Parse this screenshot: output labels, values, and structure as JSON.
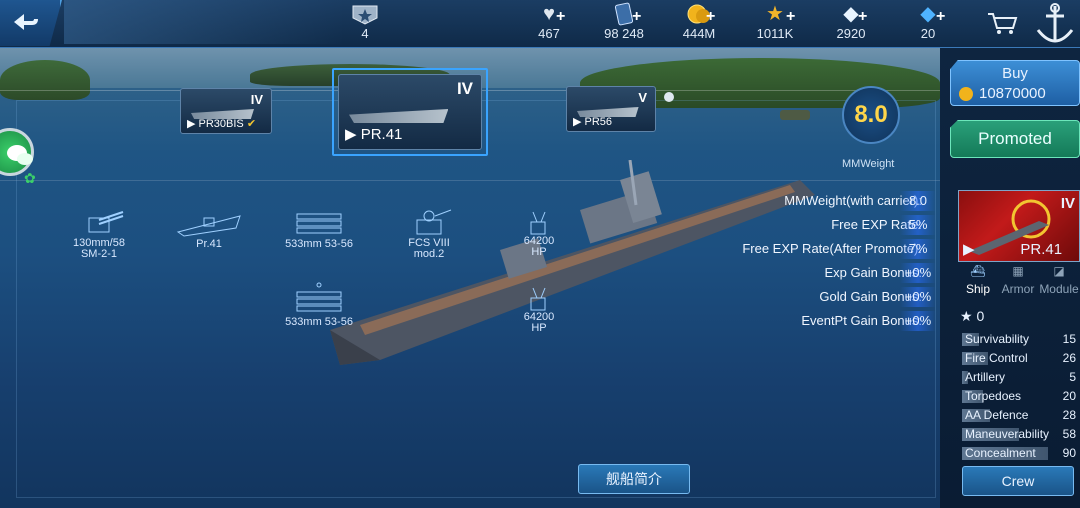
{
  "topbar": {
    "resources": [
      {
        "icon": "rank-badge-icon",
        "value": "4",
        "plus": false
      },
      {
        "icon": "heart-icon",
        "value": "467",
        "plus": true
      },
      {
        "icon": "card-icon",
        "value": "98 248",
        "plus": true
      },
      {
        "icon": "gold-coin-icon",
        "value": "444M",
        "plus": true
      },
      {
        "icon": "star-icon",
        "value": "1011K",
        "plus": true
      },
      {
        "icon": "diamond-icon",
        "value": "2920",
        "plus": true
      },
      {
        "icon": "crystal-icon",
        "value": "20",
        "plus": true
      }
    ]
  },
  "ships": [
    {
      "tier": "IV",
      "name": "PR30BIS"
    },
    {
      "tier": "IV",
      "name": "PR.41"
    },
    {
      "tier": "V",
      "name": "PR56"
    }
  ],
  "mmweight": {
    "value": "8.0",
    "label": "MMWeight"
  },
  "stats": [
    {
      "label": "MMWeight(with carrier):",
      "value": "8.0"
    },
    {
      "label": "Free EXP Rate:",
      "value": "5%"
    },
    {
      "label": "Free EXP Rate(After Promote):",
      "value": "7%"
    },
    {
      "label": "Exp Gain Bonus:",
      "value": "+0%"
    },
    {
      "label": "Gold Gain Bonus:",
      "value": "+0%"
    },
    {
      "label": "EventPt Gain Bonus:",
      "value": "+0%"
    }
  ],
  "weapons": [
    {
      "line1": "130mm/58",
      "line2": "SM-2-1"
    },
    {
      "line1": "Pr.41",
      "line2": ""
    },
    {
      "line1": "533mm 53-56",
      "line2": ""
    },
    {
      "line1": "FCS VIII",
      "line2": "mod.2"
    },
    {
      "line1": "64200",
      "line2": "HP"
    },
    {
      "line1": "533mm 53-56",
      "line2": ""
    },
    {
      "line1": "64200",
      "line2": "HP"
    }
  ],
  "side_panel": {
    "buy_label": "Buy",
    "buy_price": "10870000",
    "promoted_label": "Promoted",
    "ship_tier": "IV",
    "ship_name": "PR.41",
    "tabs": [
      "Ship",
      "Armor",
      "Module"
    ],
    "rating": "0",
    "attributes": [
      {
        "label": "Survivability",
        "value": "15",
        "fill": 0.2
      },
      {
        "label": "Fire Control",
        "value": "26",
        "fill": 0.3
      },
      {
        "label": "Artillery",
        "value": "5",
        "fill": 0.07
      },
      {
        "label": "Torpedoes",
        "value": "20",
        "fill": 0.24
      },
      {
        "label": "AA Defence",
        "value": "28",
        "fill": 0.32
      },
      {
        "label": "Maneuverability",
        "value": "58",
        "fill": 0.66
      },
      {
        "label": "Concealment",
        "value": "90",
        "fill": 1.0
      }
    ],
    "crew_label": "Crew"
  },
  "intro_button": "舰船简介"
}
